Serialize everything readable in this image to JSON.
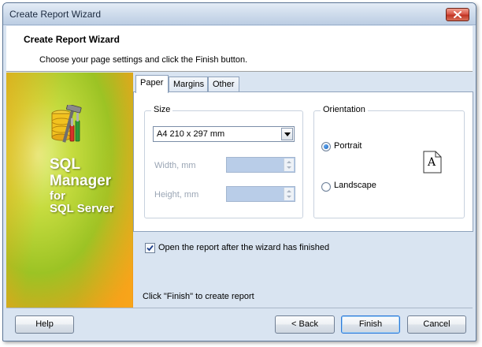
{
  "window": {
    "title": "Create Report Wizard"
  },
  "header": {
    "title": "Create Report Wizard",
    "subtitle": "Choose your page settings and click the Finish button."
  },
  "banner": {
    "product_line1": "SQL",
    "product_line2": "Manager",
    "product_line3": "for",
    "product_line4": "SQL Server"
  },
  "tabs": [
    {
      "label": "Paper",
      "active": true
    },
    {
      "label": "Margins",
      "active": false
    },
    {
      "label": "Other",
      "active": false
    }
  ],
  "size": {
    "legend": "Size",
    "paper_value": "A4 210 x 297 mm",
    "width_label": "Width, mm",
    "width_value": "",
    "height_label": "Height, mm",
    "height_value": ""
  },
  "orientation": {
    "legend": "Orientation",
    "portrait_label": "Portrait",
    "landscape_label": "Landscape",
    "selected": "Portrait",
    "preview_glyph": "A"
  },
  "open_after": {
    "label": "Open the report after the wizard has finished",
    "checked": true
  },
  "status_text": "Click \"Finish\" to create report",
  "buttons": {
    "help": "Help",
    "back": "< Back",
    "finish": "Finish",
    "cancel": "Cancel"
  },
  "colors": {
    "window_bg": "#d9e4f1",
    "disabled_field": "#b9cde8",
    "default_button_border": "#2f79d8",
    "close_button": "#c13524"
  }
}
